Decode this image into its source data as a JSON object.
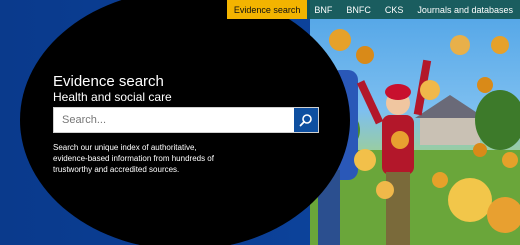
{
  "nav": {
    "items": [
      {
        "label": "Evidence search",
        "active": true
      },
      {
        "label": "BNF",
        "active": false
      },
      {
        "label": "BNFC",
        "active": false
      },
      {
        "label": "CKS",
        "active": false
      },
      {
        "label": "Journals and databases",
        "active": false
      }
    ]
  },
  "hero": {
    "title": "Evidence search",
    "subtitle": "Health and social care",
    "search_placeholder": "Search...",
    "description": "Search our unique index of authoritative, evidence-based information from hundreds of trustworthy and accredited sources."
  },
  "colors": {
    "nav_active": "#f3b400",
    "search_button": "#0e4fa0",
    "background": "#0b3f95"
  }
}
